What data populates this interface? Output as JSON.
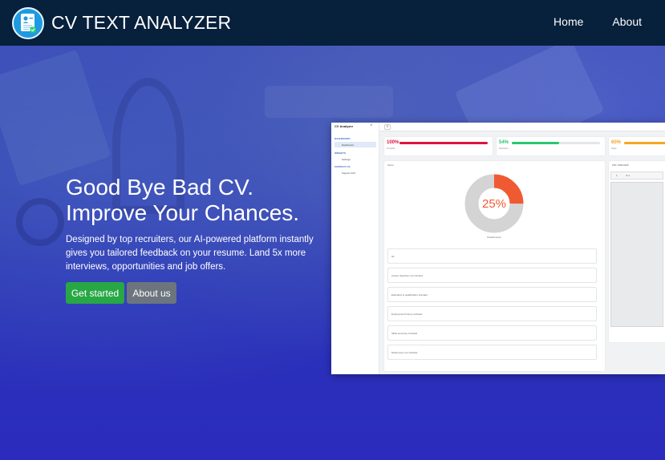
{
  "brand": {
    "name": "CV TEXT ANALYZER",
    "logo_icon": "resume-document-icon",
    "logo_color": "#1e9ae0"
  },
  "nav": {
    "links": [
      "Home",
      "About"
    ]
  },
  "hero": {
    "headline_line1": "Good Bye Bad CV.",
    "headline_line2": "Improve Your Chances.",
    "subtext": "Designed by top recruiters, our AI-powered platform instantly gives you tailored feedback on your resume. Land 5x more interviews, opportunities and job offers.",
    "primary_button": "Get started",
    "secondary_button": "About us",
    "primary_color": "#28a745",
    "secondary_color": "#6c757d"
  },
  "mockup": {
    "sidebar": {
      "title": "CV Analyzer",
      "sections": [
        {
          "label": "DASHBOARD",
          "items": [
            "Dashboard"
          ]
        },
        {
          "label": "WIDGETS",
          "items": [
            "Settings"
          ]
        },
        {
          "label": "CONTACT US",
          "items": [
            "Support 24/7"
          ]
        }
      ]
    },
    "stats": [
      {
        "value": "100%",
        "label": "Contact",
        "fill": 1.0,
        "color": "#dc143c"
      },
      {
        "value": "54%",
        "label": "Sections",
        "fill": 0.54,
        "color": "#28c76f"
      },
      {
        "value": "60%",
        "label": "Style",
        "fill": 0.6,
        "color": "#f5a623"
      }
    ],
    "score_panel_title": "Score",
    "donut": {
      "value_label": "25%",
      "fraction": 0.25,
      "caption": "Overall score",
      "fill_color": "#f05a33",
      "track_color": "#d4d4d4"
    },
    "checks": [
      "All",
      "Career objective not included",
      "Education & qualification included",
      "Employment history included",
      "Skills summary included",
      "References not included"
    ],
    "preview": {
      "title": "PDF PREVIEW",
      "page": "1",
      "page_total": "of 1"
    }
  }
}
